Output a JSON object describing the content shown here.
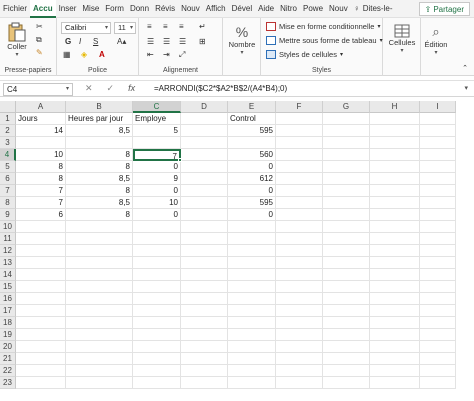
{
  "menu": {
    "tabs": [
      "Fichier",
      "Accu",
      "Inser",
      "Mise",
      "Form",
      "Donn",
      "Révis",
      "Nouv",
      "Affich",
      "Dével",
      "Aide",
      "Nitro",
      "Powe",
      "Nouv"
    ],
    "active_index": 1,
    "tell_me": "Dites-le-",
    "share_label": "Partager"
  },
  "ribbon": {
    "clipboard": {
      "paste_label": "Coller",
      "group_label": "Presse-papiers"
    },
    "font": {
      "font_name": "Calibri",
      "font_size": "11",
      "bold": "G",
      "italic": "I",
      "underline": "S",
      "group_label": "Police"
    },
    "alignment": {
      "group_label": "Alignement"
    },
    "number": {
      "label": "Nombre"
    },
    "styles": {
      "conditional": "Mise en forme conditionnelle",
      "as_table": "Mettre sous forme de tableau",
      "cell_styles": "Styles de cellules",
      "group_label": "Styles"
    },
    "cells": {
      "label": "Cellules"
    },
    "editing": {
      "label": "Édition"
    }
  },
  "formula_bar": {
    "name_box": "C4",
    "formula": "=ARRONDI($C2*$A2*B$2/(A4*B4);0)"
  },
  "grid": {
    "columns": [
      "A",
      "B",
      "C",
      "D",
      "E",
      "F",
      "G",
      "H",
      "I"
    ],
    "selected_column": "C",
    "selected_row": 4,
    "active_cell": "C4",
    "rows": [
      1,
      2,
      3,
      4,
      5,
      6,
      7,
      8,
      9,
      10,
      11,
      12,
      13,
      14,
      15,
      16,
      17,
      18,
      19,
      20,
      21,
      22,
      23
    ],
    "cells": [
      {
        "ref": "A1",
        "v": "Jours",
        "t": "txt"
      },
      {
        "ref": "B1",
        "v": "Heures par jour",
        "t": "txt"
      },
      {
        "ref": "C1",
        "v": "Employe",
        "t": "txt"
      },
      {
        "ref": "E1",
        "v": "Control",
        "t": "txt"
      },
      {
        "ref": "A2",
        "v": "14",
        "t": "num"
      },
      {
        "ref": "B2",
        "v": "8,5",
        "t": "num"
      },
      {
        "ref": "C2",
        "v": "5",
        "t": "num"
      },
      {
        "ref": "E2",
        "v": "595",
        "t": "num"
      },
      {
        "ref": "A4",
        "v": "10",
        "t": "num"
      },
      {
        "ref": "B4",
        "v": "8",
        "t": "num"
      },
      {
        "ref": "C4",
        "v": "7",
        "t": "num"
      },
      {
        "ref": "E4",
        "v": "560",
        "t": "num"
      },
      {
        "ref": "A5",
        "v": "8",
        "t": "num"
      },
      {
        "ref": "B5",
        "v": "8",
        "t": "num"
      },
      {
        "ref": "C5",
        "v": "0",
        "t": "num"
      },
      {
        "ref": "E5",
        "v": "0",
        "t": "num"
      },
      {
        "ref": "A6",
        "v": "8",
        "t": "num"
      },
      {
        "ref": "B6",
        "v": "8,5",
        "t": "num"
      },
      {
        "ref": "C6",
        "v": "9",
        "t": "num"
      },
      {
        "ref": "E6",
        "v": "612",
        "t": "num"
      },
      {
        "ref": "A7",
        "v": "7",
        "t": "num"
      },
      {
        "ref": "B7",
        "v": "8",
        "t": "num"
      },
      {
        "ref": "C7",
        "v": "0",
        "t": "num"
      },
      {
        "ref": "E7",
        "v": "0",
        "t": "num"
      },
      {
        "ref": "A8",
        "v": "7",
        "t": "num"
      },
      {
        "ref": "B8",
        "v": "8,5",
        "t": "num"
      },
      {
        "ref": "C8",
        "v": "10",
        "t": "num"
      },
      {
        "ref": "E8",
        "v": "595",
        "t": "num"
      },
      {
        "ref": "A9",
        "v": "6",
        "t": "num"
      },
      {
        "ref": "B9",
        "v": "8",
        "t": "num"
      },
      {
        "ref": "C9",
        "v": "0",
        "t": "num"
      },
      {
        "ref": "E9",
        "v": "0",
        "t": "num"
      }
    ]
  },
  "colors": {
    "accent": "#217346",
    "header_bg": "#e9e9e9",
    "gridline": "#e3e3e3"
  }
}
